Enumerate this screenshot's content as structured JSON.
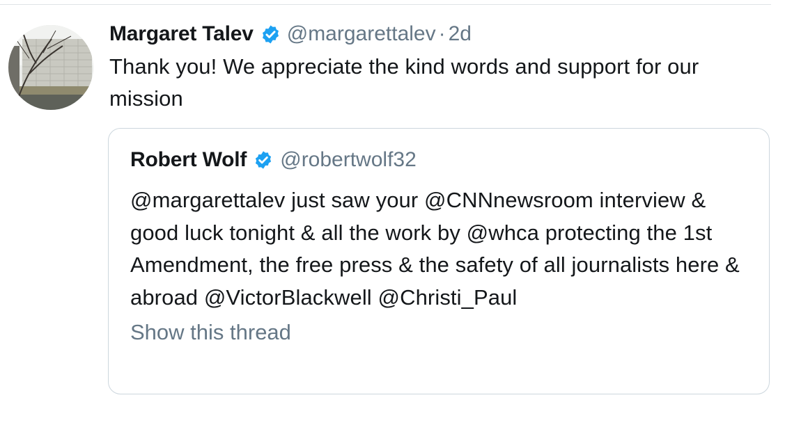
{
  "tweet": {
    "author": {
      "display_name": "Margaret Talev",
      "handle": "@margarettalev",
      "verified": true,
      "avatar": "avatar"
    },
    "separator": "·",
    "timestamp": "2d",
    "text": "Thank you! We appreciate the kind words and support for our mission"
  },
  "quoted_tweet": {
    "author": {
      "display_name": "Robert Wolf",
      "handle": "@robertwolf32",
      "verified": true
    },
    "text": "@margarettalev just saw your @CNNnewsroom interview & good luck tonight & all the work by @whca protecting the 1st Amendment, the free press & the safety of all journalists here & abroad @VictorBlackwell @Christi_Paul",
    "show_thread_label": "Show this thread"
  },
  "icons": {
    "verified": "verified-badge-icon"
  },
  "colors": {
    "text": "#14171a",
    "secondary": "#657786",
    "verified": "#1da1f2",
    "border": "#ccd6dd",
    "divider": "#dfe3e7"
  }
}
